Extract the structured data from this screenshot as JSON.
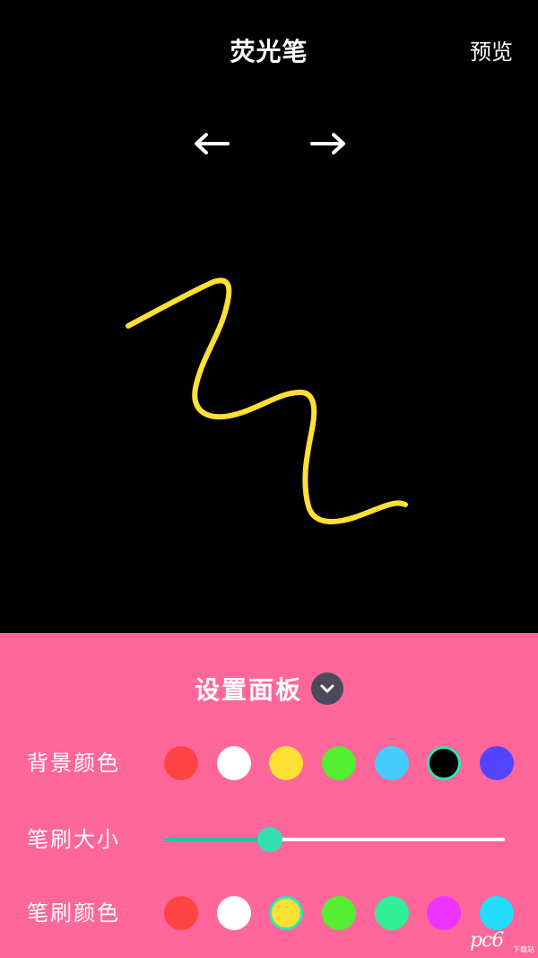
{
  "header": {
    "title": "荧光笔",
    "preview_label": "预览"
  },
  "nav": {
    "back_icon": "arrow-left-icon",
    "forward_icon": "arrow-right-icon"
  },
  "canvas": {
    "stroke_color": "#ffe033",
    "background_color": "#000000"
  },
  "panel": {
    "background_color": "#ff6699",
    "title": "设置面板",
    "collapse_icon": "chevron-down-icon",
    "background_color_row": {
      "label": "背景颜色",
      "swatches": [
        "#ff4444",
        "#ffffff",
        "#ffe033",
        "#55ee33",
        "#44ccff",
        "#000000",
        "#5544ff"
      ],
      "selected_index": 5
    },
    "brush_size_row": {
      "label": "笔刷大小",
      "value_fraction": 0.31,
      "fill_color": "#22c4a3",
      "thumb_color": "#33dfb0"
    },
    "brush_color_row": {
      "label": "笔刷颜色",
      "swatches": [
        "#ff4444",
        "#ffffff",
        "#ffe033",
        "#55ee33",
        "#33ee99",
        "#ee33ff",
        "#22ddff"
      ],
      "selected_index": 2
    }
  },
  "watermark": {
    "text": "pc6",
    "sub": "下载站"
  }
}
